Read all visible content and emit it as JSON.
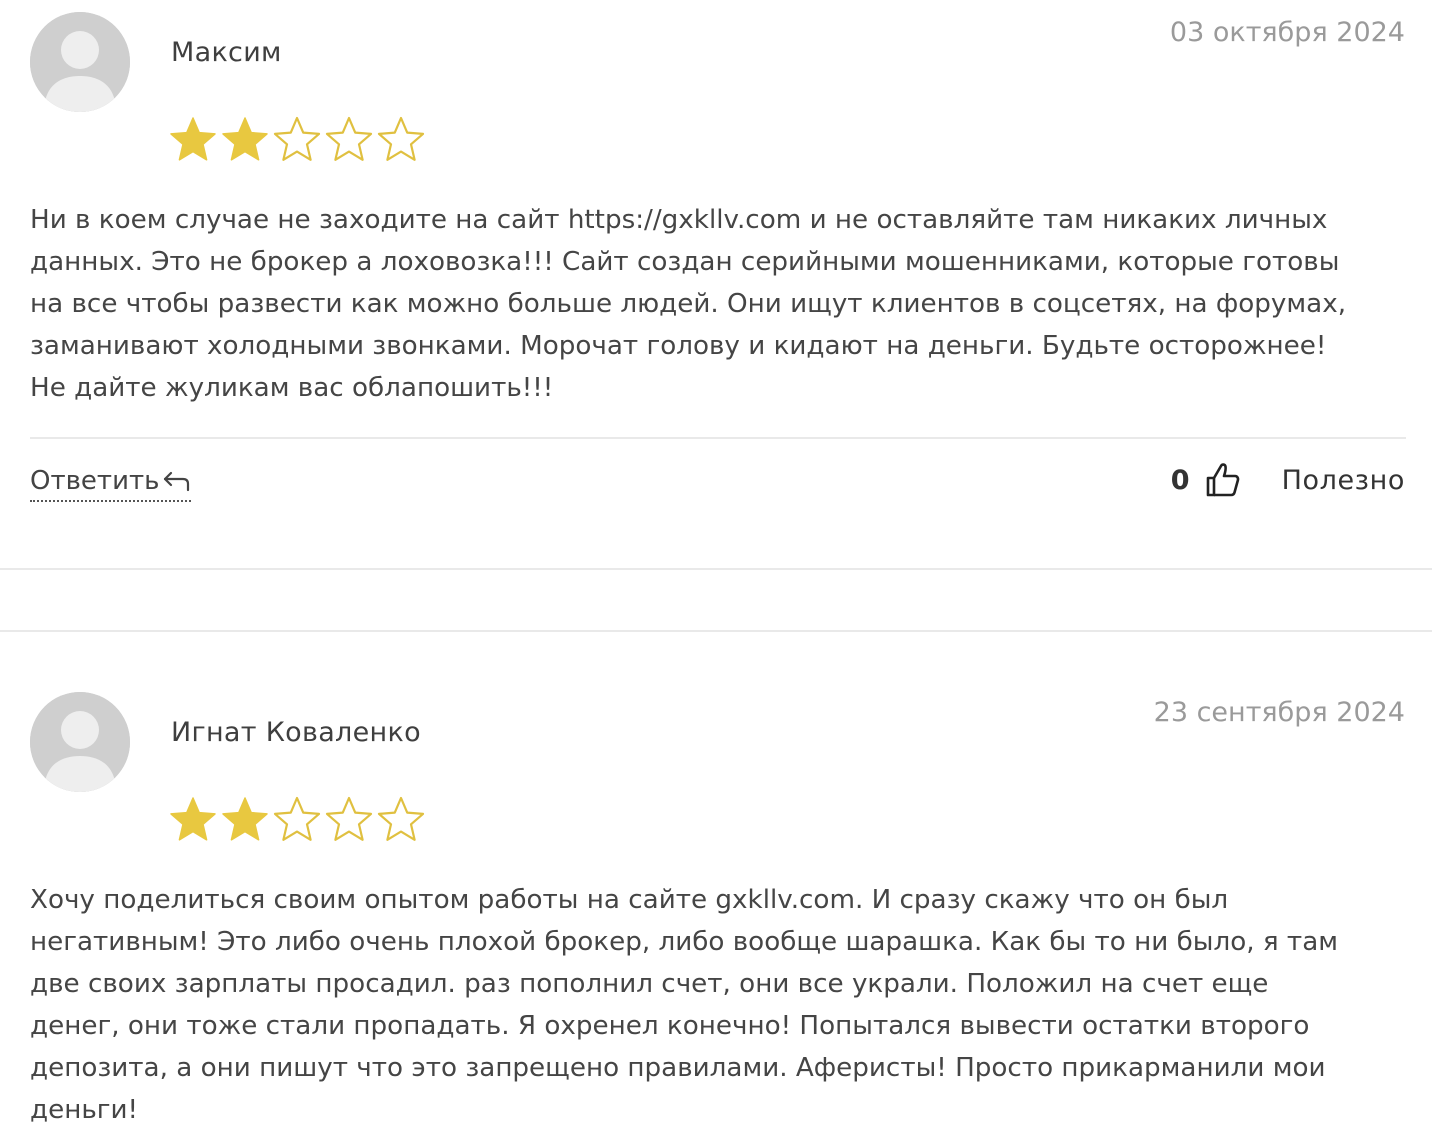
{
  "reviews": [
    {
      "author": "Максим",
      "date": "03 октября 2024",
      "rating": 2,
      "rating_max": 5,
      "lines": [
        "Ни в коем случае не заходите на сайт https://gxkllv.com и не оставляйте там никаких личных",
        "данных. Это не брокер а лоховозка!!! Сайт создан серийными мошенниками, которые готовы",
        "на все чтобы развести как можно больше людей. Они ищут клиентов в соцсетях, на форумах,",
        "заманивают холодными звонками. Морочат голову и кидают на деньги. Будьте осторожнее!",
        "Не дайте жуликам вас облапошить!!!"
      ],
      "reply_label": "Ответить",
      "useful_count": "0",
      "useful_label": "Полезно"
    },
    {
      "author": "Игнат Коваленко",
      "date": "23 сентября 2024",
      "rating": 2,
      "rating_max": 5,
      "lines": [
        "Хочу поделиться своим опытом работы на сайте gxkllv.com. И сразу скажу что он был",
        "негативным! Это либо очень плохой брокер, либо вообще шарашка. Как бы то ни было, я там",
        "две своих зарплаты просадил. раз пополнил счет, они все украли. Положил на счет еще",
        "денег, они тоже стали пропадать. Я охренел конечно! Попытался вывести остатки второго",
        "депозита, а они пишут что это запрещено правилами. Аферисты! Просто прикарманили мои",
        "деньги!"
      ]
    }
  ],
  "colors": {
    "star_fill": "#e8c840",
    "star_outline": "#e0c040",
    "avatar_bg": "#cfcfcf",
    "avatar_fg": "#eeeeee",
    "divider": "#e9e9e9",
    "date": "#9a9a9a"
  },
  "icons": {
    "avatar": "user-silhouette-icon",
    "reply": "reply-arrow-icon",
    "useful": "thumbs-up-icon",
    "star_filled": "star-filled-icon",
    "star_empty": "star-outline-icon"
  }
}
